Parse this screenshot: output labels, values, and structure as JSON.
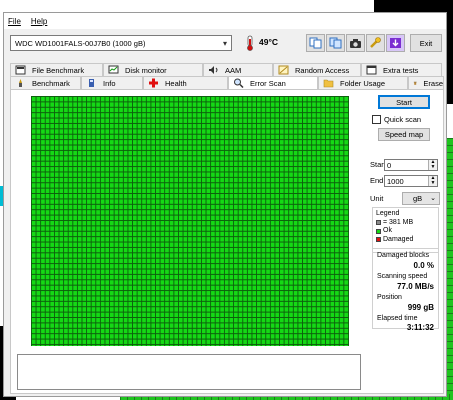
{
  "menu": {
    "file": "File",
    "help": "Help"
  },
  "toolbar": {
    "drive": "WDC WD1001FALS-00J7B0 (1000 gB)",
    "temperature": "49°C",
    "exit_label": "Exit"
  },
  "tabs_top": [
    {
      "label": "File Benchmark",
      "icon": "file-benchmark-icon"
    },
    {
      "label": "Disk monitor",
      "icon": "disk-monitor-icon"
    },
    {
      "label": "AAM",
      "icon": "speaker-icon"
    },
    {
      "label": "Random Access",
      "icon": "random-access-icon"
    },
    {
      "label": "Extra tests",
      "icon": "extra-tests-icon"
    }
  ],
  "tabs_bottom": [
    {
      "label": "Benchmark",
      "icon": "benchmark-icon"
    },
    {
      "label": "Info",
      "icon": "info-icon"
    },
    {
      "label": "Health",
      "icon": "health-icon"
    },
    {
      "label": "Error Scan",
      "icon": "error-scan-icon",
      "active": true
    },
    {
      "label": "Folder Usage",
      "icon": "folder-icon"
    },
    {
      "label": "Erase",
      "icon": "erase-icon"
    }
  ],
  "controls": {
    "start_button": "Start",
    "quick_scan": "Quick scan",
    "quick_scan_checked": false,
    "speed_map": "Speed map",
    "start_label": "Start",
    "start_value": "0",
    "end_label": "End",
    "end_value": "1000",
    "unit_label": "Unit",
    "unit_value": "gB"
  },
  "legend": {
    "title": "Legend",
    "block": "= 381 MB",
    "ok": "Ok",
    "damaged": "Damaged",
    "colors": {
      "block": "#8a8a8a",
      "ok": "#15d915",
      "damaged": "#e01010"
    }
  },
  "stats": {
    "damaged_label": "Damaged blocks",
    "damaged_value": "0.0 %",
    "speed_label": "Scanning speed",
    "speed_value": "77.0 MB/s",
    "position_label": "Position",
    "position_value": "999 gB",
    "elapsed_label": "Elapsed time",
    "elapsed_value": "3:11:32"
  }
}
